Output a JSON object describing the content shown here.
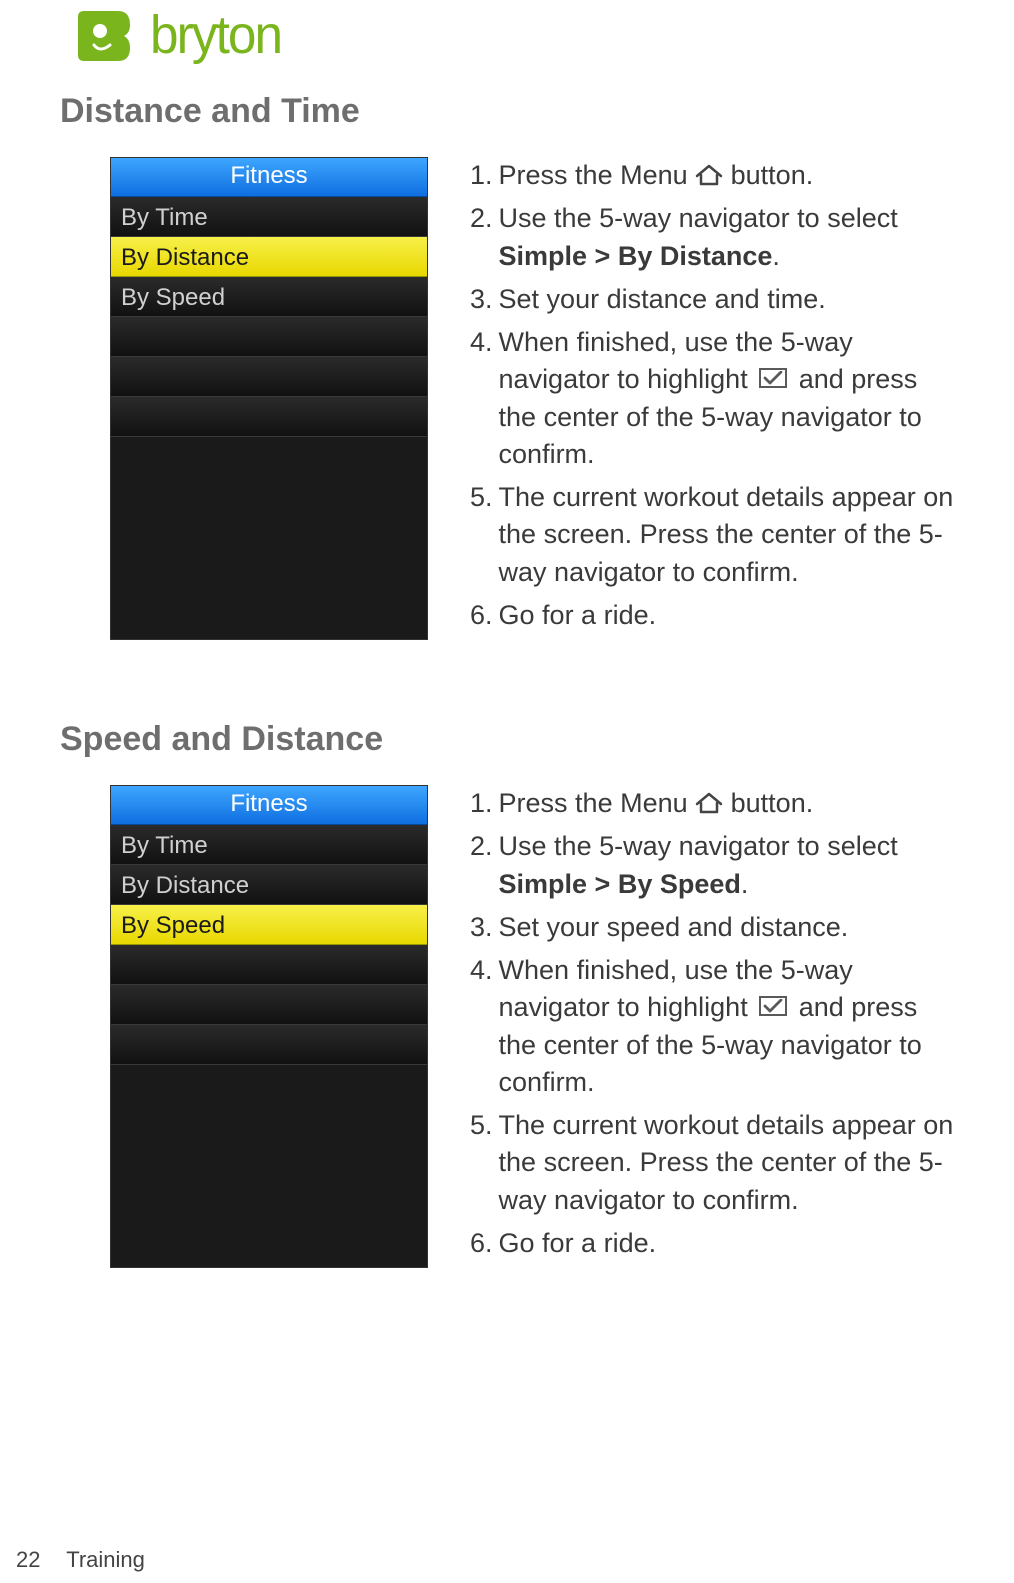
{
  "brand": "bryton",
  "sections": [
    {
      "title": "Distance and Time",
      "device": {
        "header": "Fitness",
        "rows": [
          "By Time",
          "By Distance",
          "By Speed",
          "",
          "",
          ""
        ],
        "selected_index": 1
      },
      "steps": {
        "s1a": "Press the Menu ",
        "s1b": " button.",
        "s2a": "Use the 5-way navigator to select ",
        "s2bold": "Simple > By Distance",
        "s2b": ".",
        "s3": "Set your distance and time.",
        "s4a": "When finished, use the 5-way navigator to highlight  ",
        "s4b": " and press the center of the 5-way navigator to confirm.",
        "s5": "The current workout details appear on the screen. Press the center of the 5-way navigator to confirm.",
        "s6": "Go for a ride."
      }
    },
    {
      "title": "Speed and Distance",
      "device": {
        "header": "Fitness",
        "rows": [
          "By Time",
          "By Distance",
          "By Speed",
          "",
          "",
          ""
        ],
        "selected_index": 2
      },
      "steps": {
        "s1a": "Press the Menu ",
        "s1b": " button.",
        "s2a": "Use the 5-way navigator to select ",
        "s2bold": "Simple > By Speed",
        "s2b": ".",
        "s3": "Set your speed and distance.",
        "s4a": "When finished, use the 5-way navigator to highlight  ",
        "s4b": " and press the center of the 5-way navigator to confirm.",
        "s5": "The current workout details appear on the screen. Press the center of the 5-way navigator to confirm.",
        "s6": "Go for a ride."
      }
    }
  ],
  "footer": {
    "page": "22",
    "section": "Training"
  }
}
